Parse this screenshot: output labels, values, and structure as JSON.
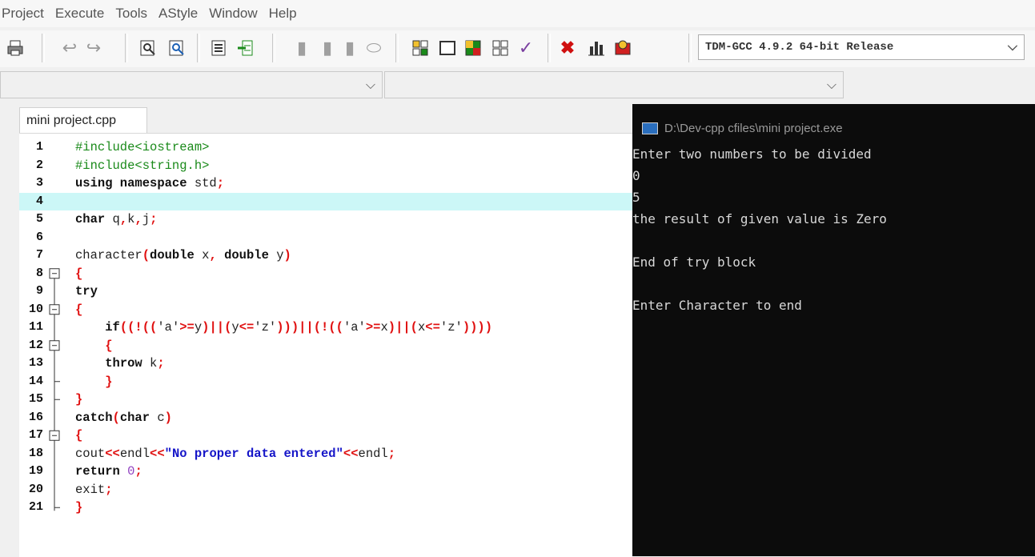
{
  "menu": [
    "Project",
    "Execute",
    "Tools",
    "AStyle",
    "Window",
    "Help"
  ],
  "toolbar": {
    "compiler": "TDM-GCC 4.9.2 64-bit Release",
    "icons": [
      "print-icon",
      "undo-icon",
      "redo-icon",
      "find-icon",
      "replace-icon",
      "indent-icon",
      "unindent-icon",
      "bookmark-icon",
      "bookmark-prev-icon",
      "bookmark-next-icon",
      "compile-icon",
      "run-icon",
      "compile-run-icon",
      "rebuild-icon",
      "syntax-check-icon",
      "stop-icon",
      "chart-icon",
      "debug-icon"
    ]
  },
  "editor": {
    "tab_label": "mini project.cpp",
    "lines": [
      {
        "n": "1",
        "tokens": [
          [
            "pp",
            "#include<iostream>"
          ]
        ]
      },
      {
        "n": "2",
        "tokens": [
          [
            "pp",
            "#include<string.h>"
          ]
        ]
      },
      {
        "n": "3",
        "tokens": [
          [
            "kw",
            "using namespace "
          ],
          [
            "txt",
            "std"
          ],
          [
            "op",
            ";"
          ]
        ]
      },
      {
        "n": "4",
        "tokens": []
      },
      {
        "n": "5",
        "tokens": [
          [
            "kw",
            "char "
          ],
          [
            "txt",
            "q"
          ],
          [
            "op",
            ","
          ],
          [
            "txt",
            "k"
          ],
          [
            "op",
            ","
          ],
          [
            "txt",
            "j"
          ],
          [
            "op",
            ";"
          ]
        ]
      },
      {
        "n": "6",
        "tokens": []
      },
      {
        "n": "7",
        "tokens": [
          [
            "txt",
            "character"
          ],
          [
            "op",
            "("
          ],
          [
            "kw",
            "double "
          ],
          [
            "txt",
            "x"
          ],
          [
            "op",
            ", "
          ],
          [
            "kw",
            "double "
          ],
          [
            "txt",
            "y"
          ],
          [
            "op",
            ")"
          ]
        ]
      },
      {
        "n": "8",
        "tokens": [
          [
            "op",
            "{"
          ]
        ]
      },
      {
        "n": "9",
        "tokens": [
          [
            "kw",
            "try"
          ]
        ]
      },
      {
        "n": "10",
        "tokens": [
          [
            "op",
            "{"
          ]
        ]
      },
      {
        "n": "11",
        "tokens": [
          [
            "txt",
            "    "
          ],
          [
            "kw",
            "if"
          ],
          [
            "op",
            "((!(("
          ],
          [
            "txt",
            "'a'"
          ],
          [
            "op",
            ">="
          ],
          [
            "txt",
            "y"
          ],
          [
            "op",
            ")||("
          ],
          [
            "txt",
            "y"
          ],
          [
            "op",
            "<="
          ],
          [
            "txt",
            "'z'"
          ],
          [
            "op",
            ")))||(!(("
          ],
          [
            "txt",
            "'a'"
          ],
          [
            "op",
            ">="
          ],
          [
            "txt",
            "x"
          ],
          [
            "op",
            ")||("
          ],
          [
            "txt",
            "x"
          ],
          [
            "op",
            "<="
          ],
          [
            "txt",
            "'z'"
          ],
          [
            "op",
            "))))"
          ]
        ]
      },
      {
        "n": "12",
        "tokens": [
          [
            "txt",
            "    "
          ],
          [
            "op",
            "{"
          ]
        ]
      },
      {
        "n": "13",
        "tokens": [
          [
            "txt",
            "    "
          ],
          [
            "kw",
            "throw "
          ],
          [
            "txt",
            "k"
          ],
          [
            "op",
            ";"
          ]
        ]
      },
      {
        "n": "14",
        "tokens": [
          [
            "txt",
            "    "
          ],
          [
            "op",
            "}"
          ]
        ]
      },
      {
        "n": "15",
        "tokens": [
          [
            "op",
            "}"
          ]
        ]
      },
      {
        "n": "16",
        "tokens": [
          [
            "kw",
            "catch"
          ],
          [
            "op",
            "("
          ],
          [
            "kw",
            "char "
          ],
          [
            "txt",
            "c"
          ],
          [
            "op",
            ")"
          ]
        ]
      },
      {
        "n": "17",
        "tokens": [
          [
            "op",
            "{"
          ]
        ]
      },
      {
        "n": "18",
        "tokens": [
          [
            "txt",
            "cout"
          ],
          [
            "op",
            "<<"
          ],
          [
            "txt",
            "endl"
          ],
          [
            "op",
            "<<"
          ],
          [
            "str",
            "\"No proper data entered\""
          ],
          [
            "op",
            "<<"
          ],
          [
            "txt",
            "endl"
          ],
          [
            "op",
            ";"
          ]
        ]
      },
      {
        "n": "19",
        "tokens": [
          [
            "kw",
            "return "
          ],
          [
            "num",
            "0"
          ],
          [
            "op",
            ";"
          ]
        ]
      },
      {
        "n": "20",
        "tokens": [
          [
            "txt",
            "exit"
          ],
          [
            "op",
            ";"
          ]
        ]
      },
      {
        "n": "21",
        "tokens": [
          [
            "op",
            "}"
          ]
        ]
      }
    ]
  },
  "console": {
    "title": "D:\\Dev-cpp cfiles\\mini project.exe",
    "lines": [
      "Enter two numbers to be divided",
      "0",
      "5",
      "the result of given value is Zero",
      "",
      "End of try block",
      "",
      "Enter Character to end"
    ]
  }
}
